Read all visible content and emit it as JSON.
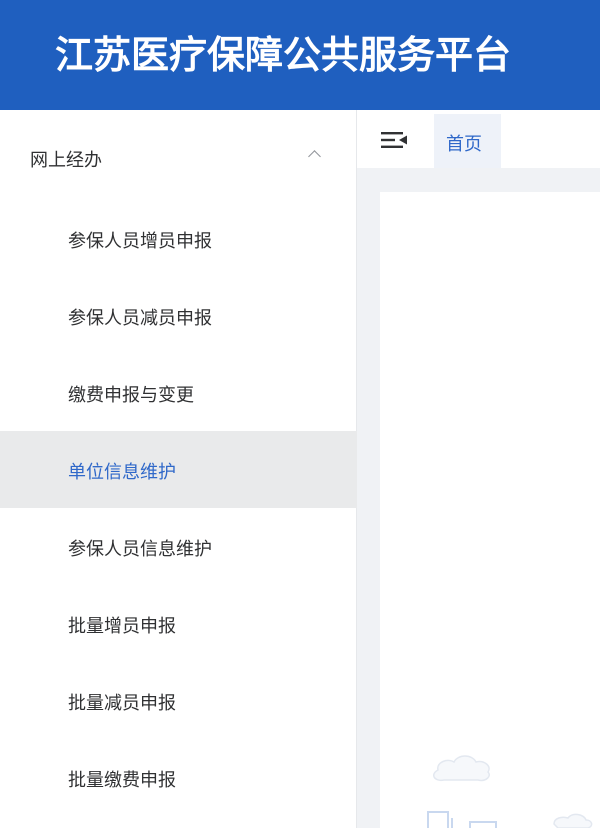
{
  "header": {
    "title": "江苏医疗保障公共服务平台"
  },
  "sidebar": {
    "group_label": "网上经办",
    "items": [
      {
        "label": "参保人员增员申报"
      },
      {
        "label": "参保人员减员申报"
      },
      {
        "label": "缴费申报与变更"
      },
      {
        "label": "单位信息维护",
        "active": true
      },
      {
        "label": "参保人员信息维护"
      },
      {
        "label": "批量增员申报"
      },
      {
        "label": "批量减员申报"
      },
      {
        "label": "批量缴费申报"
      }
    ]
  },
  "tabs": {
    "home_label": "首页"
  },
  "colors": {
    "header_bg": "#1f5fbf",
    "accent": "#2f68c9",
    "active_item_bg": "#e9eaeb",
    "content_bg": "#f0f2f5"
  },
  "icons": [
    "chevron-up-icon",
    "menu-collapse-icon",
    "cloud-illustration"
  ]
}
